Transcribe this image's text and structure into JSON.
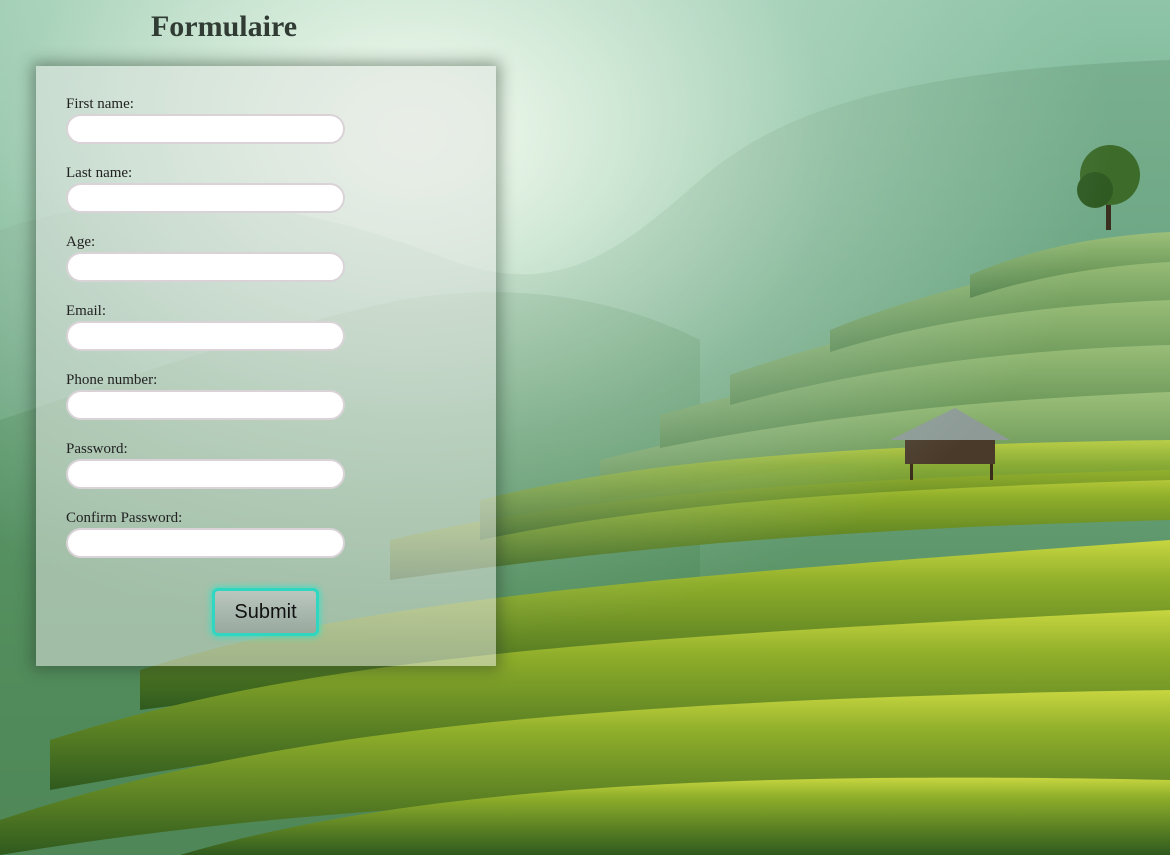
{
  "page": {
    "title": "Formulaire"
  },
  "form": {
    "fields": [
      {
        "label": "First name:",
        "value": ""
      },
      {
        "label": "Last name:",
        "value": ""
      },
      {
        "label": "Age:",
        "value": ""
      },
      {
        "label": "Email:",
        "value": ""
      },
      {
        "label": "Phone number:",
        "value": ""
      },
      {
        "label": "Password:",
        "value": ""
      },
      {
        "label": "Confirm Password:",
        "value": ""
      }
    ],
    "submit_label": "Submit"
  },
  "colors": {
    "button_border": "#2fd6c0",
    "input_border": "#d9d3d8",
    "title": "#2f3b33"
  }
}
